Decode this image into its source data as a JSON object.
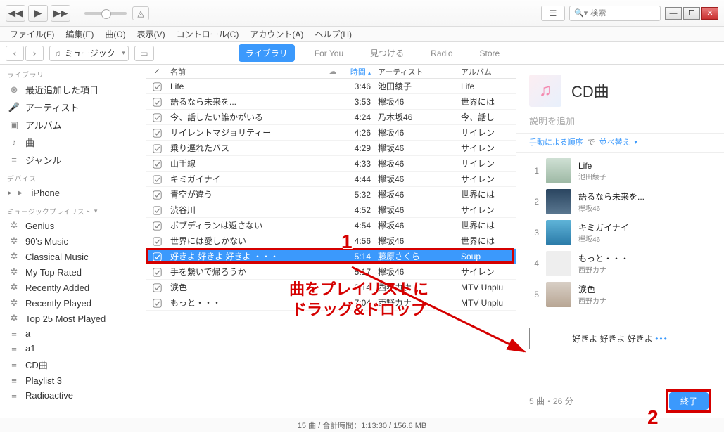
{
  "menubar": [
    "ファイル(F)",
    "編集(E)",
    "曲(O)",
    "表示(V)",
    "コントロール(C)",
    "アカウント(A)",
    "ヘルプ(H)"
  ],
  "search": {
    "placeholder": "検索"
  },
  "media_selector": "ミュージック",
  "nav_tabs": {
    "library": "ライブラリ",
    "foryou": "For You",
    "browse": "見つける",
    "radio": "Radio",
    "store": "Store"
  },
  "sidebar": {
    "library_heading": "ライブラリ",
    "library_items": [
      {
        "icon": "⊕",
        "label": "最近追加した項目"
      },
      {
        "icon": "🎤",
        "label": "アーティスト"
      },
      {
        "icon": "▣",
        "label": "アルバム"
      },
      {
        "icon": "♪",
        "label": "曲"
      },
      {
        "icon": "≡",
        "label": "ジャンル"
      }
    ],
    "devices_heading": "デバイス",
    "devices": [
      {
        "icon": "▸",
        "label": "iPhone"
      }
    ],
    "playlists_heading": "ミュージックプレイリスト",
    "playlists": [
      {
        "icon": "✲",
        "label": "Genius"
      },
      {
        "icon": "✲",
        "label": "90's Music"
      },
      {
        "icon": "✲",
        "label": "Classical Music"
      },
      {
        "icon": "✲",
        "label": "My Top Rated"
      },
      {
        "icon": "✲",
        "label": "Recently Added"
      },
      {
        "icon": "✲",
        "label": "Recently Played"
      },
      {
        "icon": "✲",
        "label": "Top 25 Most Played"
      },
      {
        "icon": "≡",
        "label": "a"
      },
      {
        "icon": "≡",
        "label": "a1"
      },
      {
        "icon": "≡",
        "label": "CD曲"
      },
      {
        "icon": "≡",
        "label": "Playlist 3"
      },
      {
        "icon": "≡",
        "label": "Radioactive"
      }
    ]
  },
  "columns": {
    "name": "名前",
    "time": "時間",
    "artist": "アーティスト",
    "album": "アルバム"
  },
  "tracks": [
    {
      "name": "Life",
      "time": "3:46",
      "artist": "池田綾子",
      "album": "Life"
    },
    {
      "name": "語るなら未来を...",
      "time": "3:53",
      "artist": "欅坂46",
      "album": "世界には"
    },
    {
      "name": "今、話したい誰かがいる",
      "time": "4:24",
      "artist": "乃木坂46",
      "album": "今、話し"
    },
    {
      "name": "サイレントマジョリティー",
      "time": "4:26",
      "artist": "欅坂46",
      "album": "サイレン"
    },
    {
      "name": "乗り遅れたバス",
      "time": "4:29",
      "artist": "欅坂46",
      "album": "サイレン"
    },
    {
      "name": "山手線",
      "time": "4:33",
      "artist": "欅坂46",
      "album": "サイレン"
    },
    {
      "name": "キミガイナイ",
      "time": "4:44",
      "artist": "欅坂46",
      "album": "サイレン"
    },
    {
      "name": "青空が違う",
      "time": "5:32",
      "artist": "欅坂46",
      "album": "世界には"
    },
    {
      "name": "渋谷川",
      "time": "4:52",
      "artist": "欅坂46",
      "album": "サイレン"
    },
    {
      "name": "ボブディランは返さない",
      "time": "4:54",
      "artist": "欅坂46",
      "album": "世界には"
    },
    {
      "name": "世界には愛しかない",
      "time": "4:56",
      "artist": "欅坂46",
      "album": "世界には"
    },
    {
      "name": "好きよ 好きよ 好きよ ・・・",
      "time": "5:14",
      "artist": "藤原さくら",
      "album": "Soup",
      "sel": true
    },
    {
      "name": "手を繋いで帰ろうか",
      "time": "5:17",
      "artist": "欅坂46",
      "album": "サイレン"
    },
    {
      "name": "涙色",
      "time": "3:14",
      "artist": "西野カナ",
      "album": "MTV Unplu"
    },
    {
      "name": "もっと・・・",
      "time": "7:04",
      "artist": "西野カナ",
      "album": "MTV Unplu"
    }
  ],
  "rightpanel": {
    "title": "CD曲",
    "desc_placeholder": "説明を追加",
    "sort_left": "手動による順序",
    "sort_mid": "で",
    "sort_right": "並べ替え",
    "list": [
      {
        "n": "1",
        "t": "Life",
        "a": "池田綾子",
        "g": "g1"
      },
      {
        "n": "2",
        "t": "語るなら未来を...",
        "a": "欅坂46",
        "g": "g2"
      },
      {
        "n": "3",
        "t": "キミガイナイ",
        "a": "欅坂46",
        "g": "g3"
      },
      {
        "n": "4",
        "t": "もっと・・・",
        "a": "西野カナ",
        "g": "g4"
      },
      {
        "n": "5",
        "t": "涙色",
        "a": "西野カナ",
        "g": "g5"
      }
    ],
    "drop_label": "好きよ 好きよ 好きよ",
    "foot_info": "5 曲・26 分",
    "done": "終了"
  },
  "statusbar": "15 曲 / 合計時間：1:13:30 / 156.6 MB",
  "annotations": {
    "step1": "1",
    "step2": "2",
    "text1": "曲をプレイリストに",
    "text2": "ドラッグ&ドロップ"
  }
}
